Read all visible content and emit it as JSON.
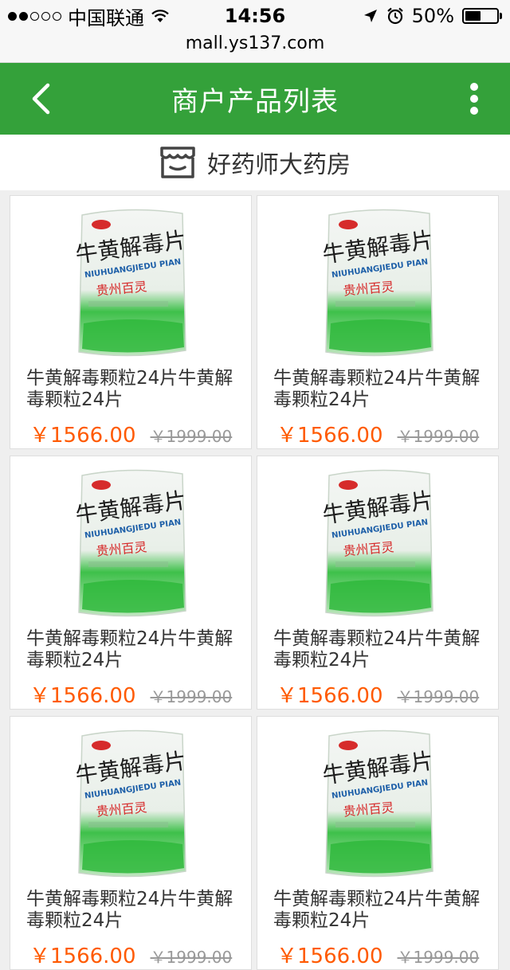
{
  "status_bar": {
    "carrier": "中国联通",
    "time": "14:56",
    "battery_percent": "50%",
    "battery_level": 0.5
  },
  "url": "mall.ys137.com",
  "header": {
    "title": "商户产品列表",
    "back_icon": "chevron-left-icon",
    "more_icon": "more-vertical-icon"
  },
  "store": {
    "icon": "store-icon",
    "name": "好药师大药房"
  },
  "colors": {
    "brand_green": "#34a13a",
    "price_orange": "#ff5a00"
  },
  "products": [
    {
      "name": "牛黄解毒颗粒24片牛黄解毒颗粒24片",
      "price": "￥1566.00",
      "original_price": "￥1999.00"
    },
    {
      "name": "牛黄解毒颗粒24片牛黄解毒颗粒24片",
      "price": "￥1566.00",
      "original_price": "￥1999.00"
    },
    {
      "name": "牛黄解毒颗粒24片牛黄解毒颗粒24片",
      "price": "￥1566.00",
      "original_price": "￥1999.00"
    },
    {
      "name": "牛黄解毒颗粒24片牛黄解毒颗粒24片",
      "price": "￥1566.00",
      "original_price": "￥1999.00"
    },
    {
      "name": "牛黄解毒颗粒24片牛黄解毒颗粒24片",
      "price": "￥1566.00",
      "original_price": "￥1999.00"
    },
    {
      "name": "牛黄解毒颗粒24片牛黄解毒颗粒24片",
      "price": "￥1566.00",
      "original_price": "￥1999.00"
    }
  ]
}
